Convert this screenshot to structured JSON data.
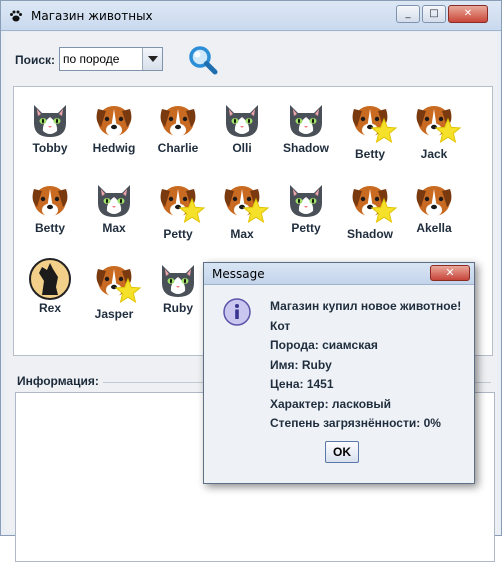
{
  "window": {
    "title": "Магазин животных",
    "controls": {
      "min": "_",
      "max": "□",
      "close": "✕"
    }
  },
  "search": {
    "label": "Поиск:",
    "selected": "по породе"
  },
  "animals": [
    {
      "name": "Tobby",
      "icon": "cat-icon",
      "star": false
    },
    {
      "name": "Hedwig",
      "icon": "dog-icon",
      "star": false
    },
    {
      "name": "Charlie",
      "icon": "dog-icon",
      "star": false
    },
    {
      "name": "Olli",
      "icon": "cat-icon",
      "star": false
    },
    {
      "name": "Shadow",
      "icon": "cat-icon",
      "star": false
    },
    {
      "name": "Betty",
      "icon": "dog-icon",
      "star": true
    },
    {
      "name": "Jack",
      "icon": "dog-icon",
      "star": true
    },
    {
      "name": "Betty",
      "icon": "dog-icon",
      "star": false
    },
    {
      "name": "Max",
      "icon": "cat-icon",
      "star": false
    },
    {
      "name": "Petty",
      "icon": "dog-icon",
      "star": true
    },
    {
      "name": "Max",
      "icon": "dog-icon",
      "star": true
    },
    {
      "name": "Petty",
      "icon": "cat-icon",
      "star": false
    },
    {
      "name": "Shadow",
      "icon": "dog-icon",
      "star": true
    },
    {
      "name": "Akella",
      "icon": "dog-icon",
      "star": false
    },
    {
      "name": "Rex",
      "icon": "wolf-icon",
      "star": false
    },
    {
      "name": "Jasper",
      "icon": "dog-icon",
      "star": true
    },
    {
      "name": "Ruby",
      "icon": "cat-icon",
      "star": false
    }
  ],
  "info": {
    "label": "Информация:"
  },
  "dialog": {
    "title": "Message",
    "close": "✕",
    "lines": [
      "Магазин купил новое животное!",
      "Кот",
      "Порода: сиамская",
      "Имя: Ruby",
      "Цена: 1451",
      "Характер: ласковый",
      "Степень загрязнённости: 0%"
    ],
    "ok": "OK"
  }
}
